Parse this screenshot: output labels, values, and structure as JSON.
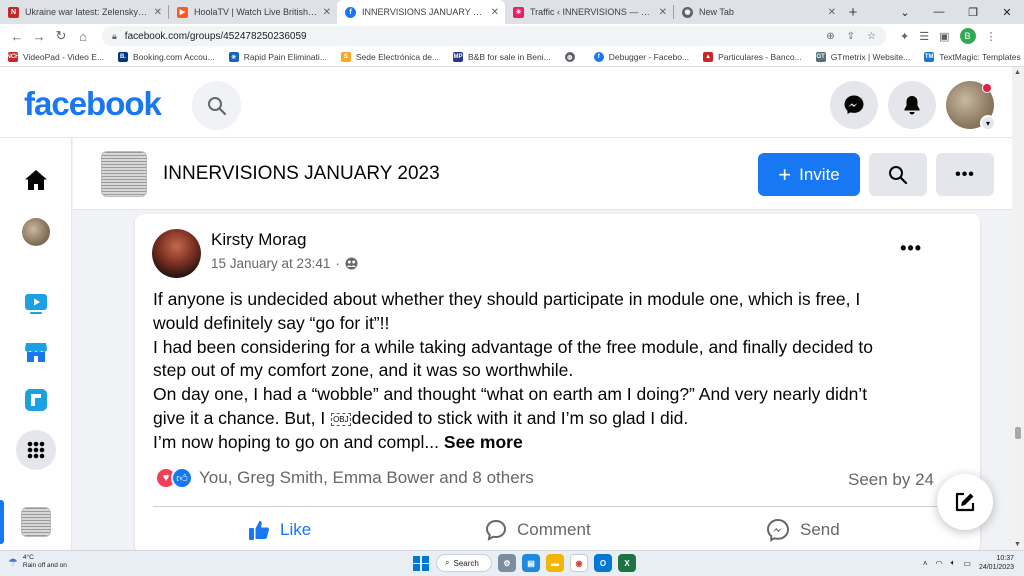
{
  "browser": {
    "tabs": [
      {
        "title": "Ukraine war latest: Zelenskyy 'to",
        "favicon": "news-red-icon",
        "active": false
      },
      {
        "title": "HoolaTV | Watch Live British TV &",
        "favicon": "play-orange-icon",
        "active": false
      },
      {
        "title": "INNERVISIONS JANUARY 2023 | F",
        "favicon": "facebook-icon",
        "active": true
      },
      {
        "title": "Traffic ‹ INNERVISIONS — WordP",
        "favicon": "asterisk-icon",
        "active": false
      },
      {
        "title": "New Tab",
        "favicon": "chrome-icon",
        "active": false
      }
    ],
    "url": "facebook.com/groups/452478250236059",
    "profile_initial": "B",
    "bookmarks": [
      {
        "label": "VideoPad - Video E...",
        "icon": "nch-icon",
        "color": "#c62828",
        "abbr": "NCH"
      },
      {
        "label": "Booking.com Accou...",
        "icon": "booking-icon",
        "color": "#003580",
        "abbr": "B."
      },
      {
        "label": "Rapid Pain Eliminati...",
        "icon": "asterisk-icon",
        "color": "#1565c0",
        "abbr": "✳"
      },
      {
        "label": "Sede Electrónica de...",
        "icon": "sede-icon",
        "color": "#f9a825",
        "abbr": "S"
      },
      {
        "label": "B&B for sale in Beni...",
        "icon": "mp-icon",
        "color": "#283593",
        "abbr": "MP"
      },
      {
        "label": "",
        "icon": "globe-icon",
        "color": "#5f6368",
        "abbr": "◍"
      },
      {
        "label": "Debugger - Facebo...",
        "icon": "facebook-icon",
        "color": "#1877f2",
        "abbr": "f"
      },
      {
        "label": "Particulares - Banco...",
        "icon": "bank-icon",
        "color": "#c62828",
        "abbr": "▲"
      },
      {
        "label": "GTmetrix | Website...",
        "icon": "gt-icon",
        "color": "#546e7a",
        "abbr": "GT"
      },
      {
        "label": "TextMagic: Templates",
        "icon": "tm-icon",
        "color": "#1976d2",
        "abbr": "TM"
      }
    ]
  },
  "facebook": {
    "logo": "facebook",
    "group": {
      "title": "INNERVISIONS JANUARY 2023",
      "invite_label": "Invite"
    },
    "post": {
      "author": "Kirsty Morag",
      "timestamp": "15 January at 23:41",
      "separator": "·",
      "lines": [
        "If anyone is undecided about whether they should participate in module one, which is free, I",
        "would definitely say “go for it”!!",
        "I had been considering for a while taking advantage of the free module, and finally decided to",
        "step out of my comfort zone, and it was so worthwhile.",
        "On day one, I had a “wobble” and thought “what on earth am I doing?” And very nearly didn’t"
      ],
      "line6_before": "give it a chance. But, I",
      "line6_obj": "OBJ",
      "line6_after": "decided to stick with it and I’m so glad I did.",
      "line7": "I’m now hoping to go on and compl...",
      "see_more": "See more",
      "reactions_text": "You, Greg Smith, Emma Bower and 8 others",
      "seen_by": "Seen by 24",
      "actions": {
        "like": "Like",
        "comment": "Comment",
        "send": "Send"
      }
    }
  },
  "taskbar": {
    "temperature": "4°C",
    "weather": "Rain off and on",
    "search_label": "Search",
    "time": "10:37",
    "date": "24/01/2023"
  },
  "colors": {
    "brand": "#1877f2",
    "love": "#f33e58",
    "notification": "#e41e3f"
  }
}
